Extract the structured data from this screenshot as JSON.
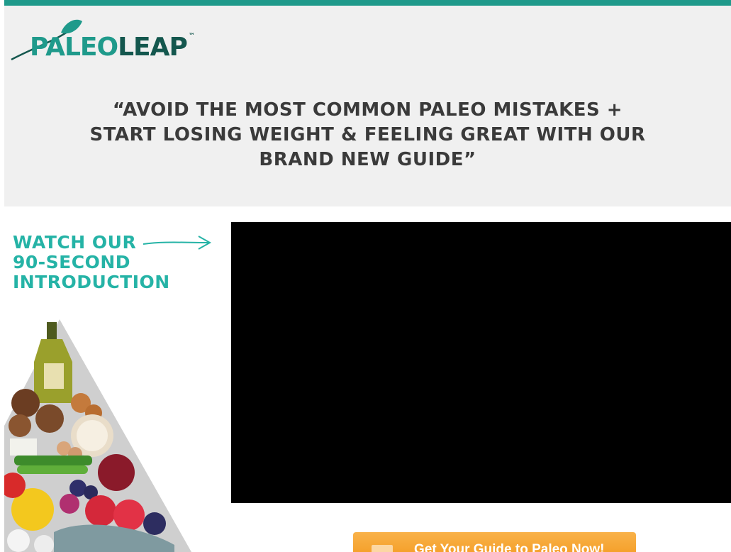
{
  "brand": {
    "logo_part1": "PALEO",
    "logo_part2": "LEAP",
    "logo_tm": "™",
    "colors": {
      "teal": "#1f9a8b",
      "teal_light": "#25b3a6",
      "dark_teal": "#14574e",
      "orange": "#f5a12f",
      "headline_gray": "#3a3a3a",
      "hero_bg": "#f0f0f0"
    }
  },
  "hero": {
    "headline_lines": [
      "“AVOID THE MOST COMMON PALEO MISTAKES +",
      "START LOSING WEIGHT & FEELING GREAT WITH OUR",
      "BRAND NEW GUIDE”"
    ]
  },
  "intro": {
    "lines": [
      "WATCH OUR",
      "90-SECOND",
      "INTRODUCTION"
    ],
    "arrow_icon": "right-arrow-icon"
  },
  "video": {
    "state": "black player area"
  },
  "cta": {
    "label": "Get Your Guide to Paleo Now!",
    "icon": "book-icon"
  },
  "illustration": {
    "name": "paleo food pyramid"
  }
}
